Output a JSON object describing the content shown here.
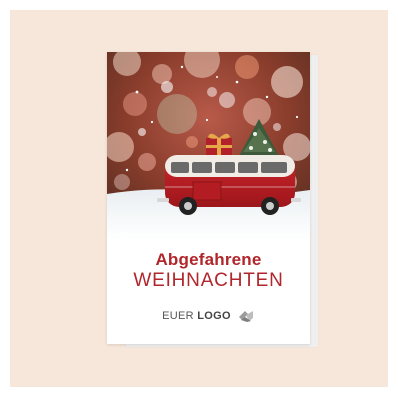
{
  "card": {
    "headline": "Abgefahrene",
    "subline": "WEIHNACHTEN",
    "logo_prefix": "EUER",
    "logo_bold": "LOGO"
  },
  "colors": {
    "background": "#f6e7da",
    "accent_red": "#b0262b",
    "logo_grey": "#9b9b9b"
  },
  "icons": [
    "gift-icon",
    "christmas-tree-icon",
    "bus-icon",
    "logo-mark-icon"
  ]
}
